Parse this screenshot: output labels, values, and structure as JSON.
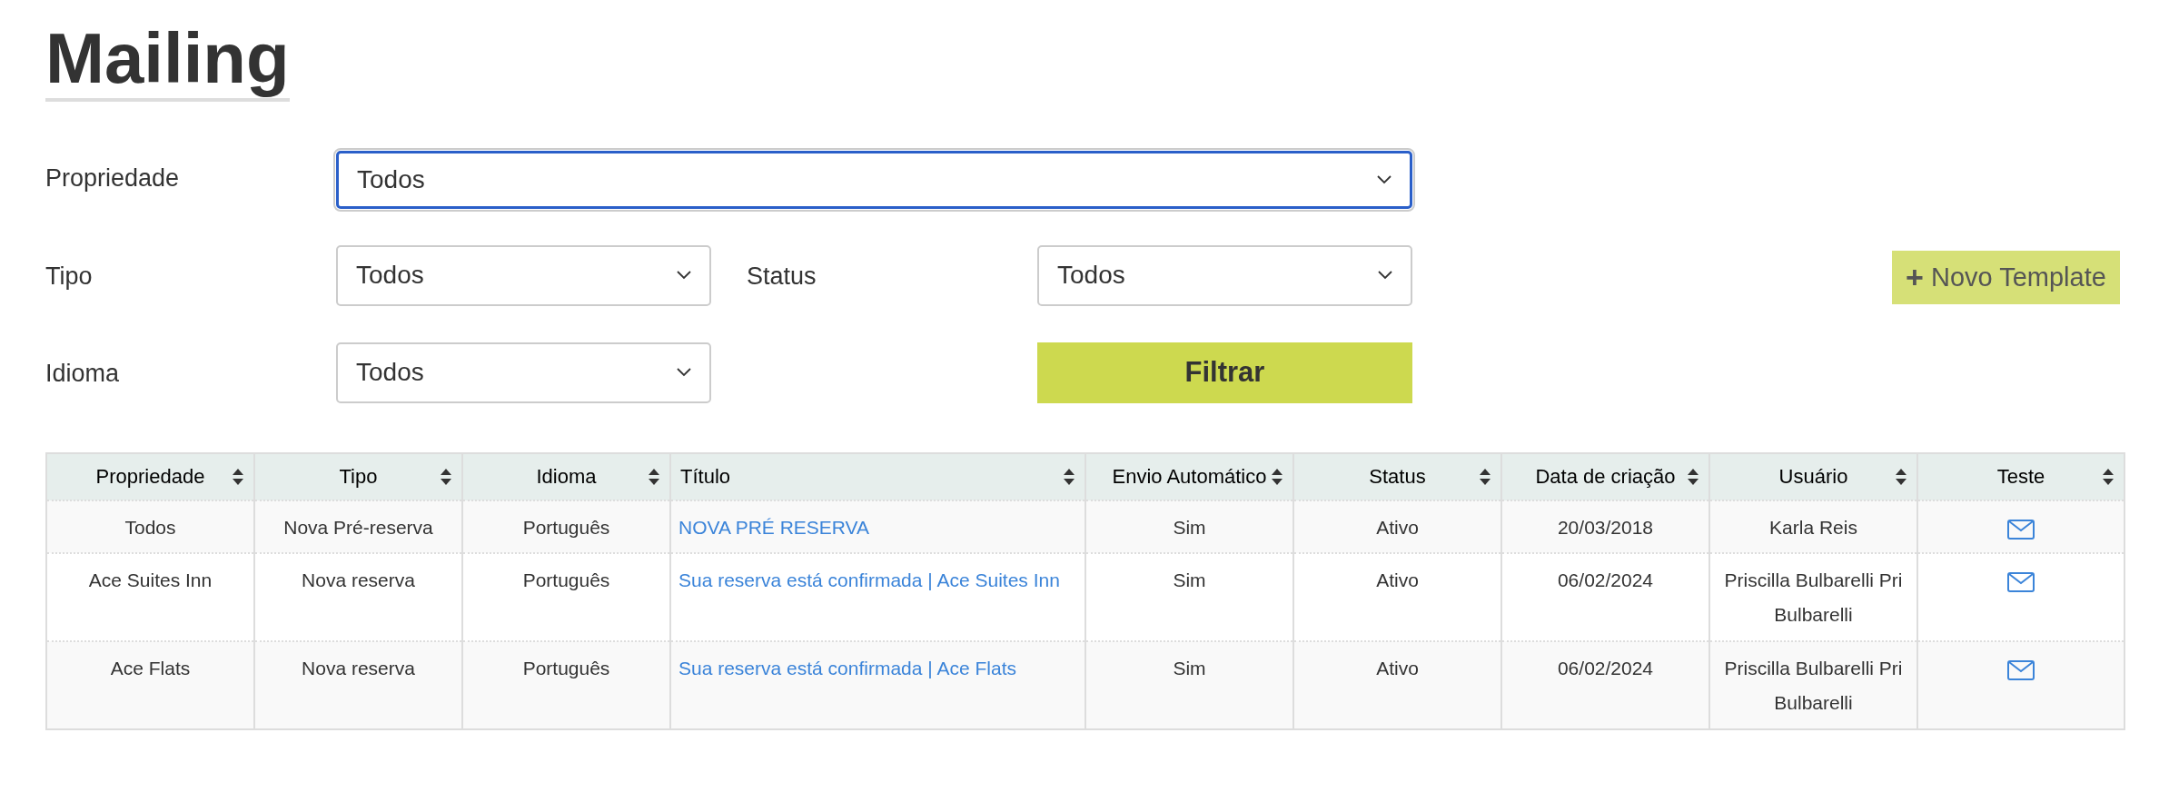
{
  "title": "Mailing",
  "filters": [
    {
      "label": "Propriedade",
      "value": "Todos",
      "focused": true
    },
    {
      "label": "Tipo",
      "value": "Todos",
      "focused": false
    },
    {
      "label": "Status",
      "value": "Todos",
      "focused": false
    },
    {
      "label": "Idioma",
      "value": "Todos",
      "focused": false
    }
  ],
  "filter_button": "Filtrar",
  "new_button": {
    "icon": "+",
    "label": "Novo Template"
  },
  "table": {
    "columns": [
      "Propriedade",
      "Tipo",
      "Idioma",
      "Título",
      "Envio Automático",
      "Status",
      "Data de criação",
      "Usuário",
      "Teste"
    ],
    "rows": [
      {
        "propriedade": "Todos",
        "tipo": "Nova Pré-reserva",
        "idioma": "Português",
        "titulo": "NOVA PRÉ RESERVA",
        "envio": "Sim",
        "status": "Ativo",
        "data": "20/03/2018",
        "usuario": "Karla Reis"
      },
      {
        "propriedade": "Ace Suites Inn",
        "tipo": "Nova reserva",
        "idioma": "Português",
        "titulo": "Sua reserva está confirmada | Ace Suites Inn",
        "envio": "Sim",
        "status": "Ativo",
        "data": "06/02/2024",
        "usuario": "Priscilla Bulbarelli Pri Bulbarelli"
      },
      {
        "propriedade": "Ace Flats",
        "tipo": "Nova reserva",
        "idioma": "Português",
        "titulo": "Sua reserva está confirmada | Ace Flats",
        "envio": "Sim",
        "status": "Ativo",
        "data": "06/02/2024",
        "usuario": "Priscilla Bulbarelli Pri Bulbarelli"
      }
    ]
  }
}
